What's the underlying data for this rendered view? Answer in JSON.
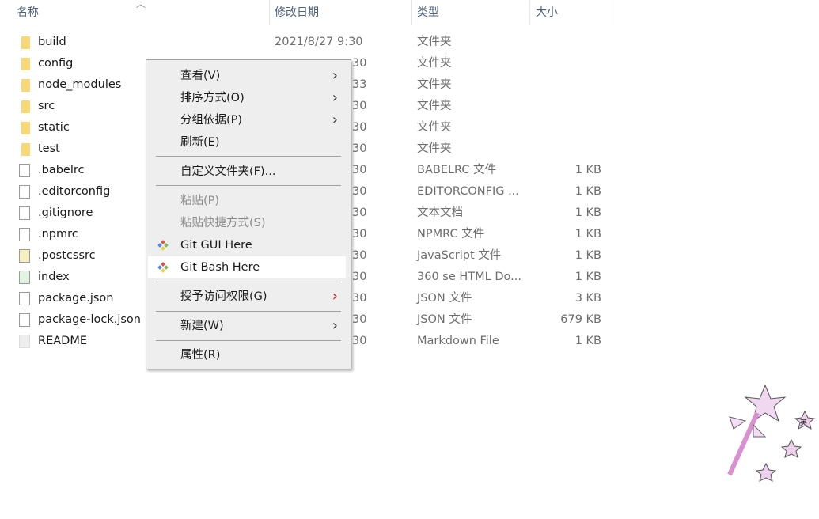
{
  "columns": {
    "name": "名称",
    "date": "修改日期",
    "type": "类型",
    "size": "大小"
  },
  "files": [
    {
      "name": "build",
      "date": "2021/8/27 9:30",
      "type": "文件夹",
      "size": "",
      "icon": "folder"
    },
    {
      "name": "config",
      "date": "30",
      "type": "文件夹",
      "size": "",
      "icon": "folder"
    },
    {
      "name": "node_modules",
      "date": "33",
      "type": "文件夹",
      "size": "",
      "icon": "folder"
    },
    {
      "name": "src",
      "date": "30",
      "type": "文件夹",
      "size": "",
      "icon": "folder"
    },
    {
      "name": "static",
      "date": "30",
      "type": "文件夹",
      "size": "",
      "icon": "folder"
    },
    {
      "name": "test",
      "date": "30",
      "type": "文件夹",
      "size": "",
      "icon": "folder"
    },
    {
      "name": ".babelrc",
      "date": "30",
      "type": "BABELRC 文件",
      "size": "1 KB",
      "icon": "file"
    },
    {
      "name": ".editorconfig",
      "date": "30",
      "type": "EDITORCONFIG ...",
      "size": "1 KB",
      "icon": "file"
    },
    {
      "name": ".gitignore",
      "date": "30",
      "type": "文本文档",
      "size": "1 KB",
      "icon": "text-file"
    },
    {
      "name": ".npmrc",
      "date": "30",
      "type": "NPMRC 文件",
      "size": "1 KB",
      "icon": "file"
    },
    {
      "name": ".postcssrc",
      "date": "30",
      "type": "JavaScript 文件",
      "size": "1 KB",
      "icon": "script-file"
    },
    {
      "name": "index",
      "date": "30",
      "type": "360 se HTML Do...",
      "size": "1 KB",
      "icon": "html-file"
    },
    {
      "name": "package.json",
      "date": "30",
      "type": "JSON 文件",
      "size": "3 KB",
      "icon": "file"
    },
    {
      "name": "package-lock.json",
      "date": "30",
      "type": "JSON 文件",
      "size": "679 KB",
      "icon": "file"
    },
    {
      "name": "README",
      "date": "30",
      "type": "Markdown File",
      "size": "1 KB",
      "icon": "markdown-file"
    }
  ],
  "menu": {
    "view": "查看(V)",
    "sort": "排序方式(O)",
    "group": "分组依据(P)",
    "refresh": "刷新(E)",
    "customize": "自定义文件夹(F)...",
    "paste": "粘贴(P)",
    "paste_shortcut": "粘贴快捷方式(S)",
    "git_gui": "Git GUI Here",
    "git_bash": "Git Bash Here",
    "grant": "授予访问权限(G)",
    "new": "新建(W)",
    "properties": "属性(R)"
  },
  "ime": {
    "label": "英"
  }
}
